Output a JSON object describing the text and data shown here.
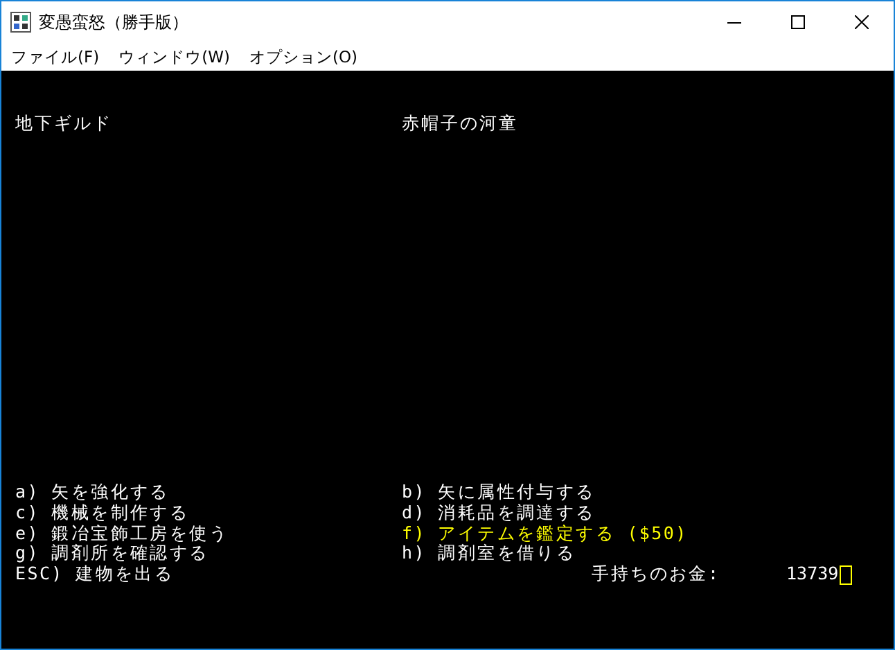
{
  "window": {
    "title": "変愚蛮怒（勝手版）"
  },
  "menu": [
    "ファイル(F)",
    "ウィンドウ(W)",
    "オプション(O)"
  ],
  "headers": [
    "地下ギルド",
    "赤帽子の河童"
  ],
  "options": [
    {
      "text": "a) 矢を強化する",
      "highlighted": false
    },
    {
      "text": "b) 矢に属性付与する",
      "highlighted": false
    },
    {
      "text": "c) 機械を制作する",
      "highlighted": false
    },
    {
      "text": "d) 消耗品を調達する",
      "highlighted": false
    },
    {
      "text": "e) 鍛冶宝飾工房を使う",
      "highlighted": false
    },
    {
      "text": "f) アイテムを鑑定する ($50)",
      "highlighted": true
    },
    {
      "text": "g) 調剤所を確認する",
      "highlighted": false
    },
    {
      "text": "h) 調剤室を借りる",
      "highlighted": false
    },
    {
      "text": "ESC) 建物を出る",
      "highlighted": false
    }
  ],
  "gold": {
    "label": "手持ちのお金:",
    "value": "13739"
  }
}
